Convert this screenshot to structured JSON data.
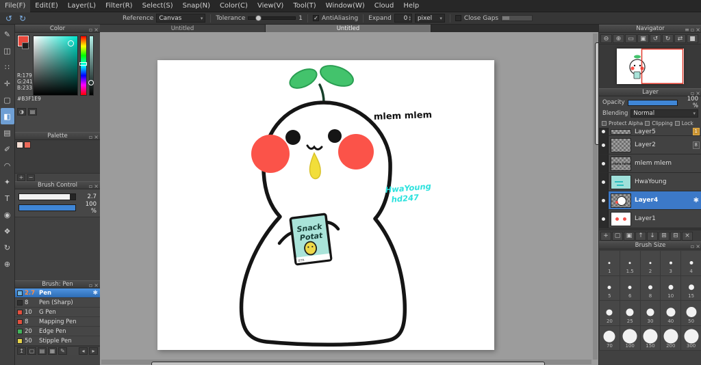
{
  "icons": {
    "float": "▫",
    "close": "×",
    "caret": "▾",
    "check": "✓",
    "undo": "↺",
    "redo": "↻",
    "spin_up": "▴",
    "spin_down": "▾",
    "gear": "✱",
    "menu": "≡"
  },
  "menu": {
    "items": [
      "File(F)",
      "Edit(E)",
      "Layer(L)",
      "Filter(R)",
      "Select(S)",
      "Snap(N)",
      "Color(C)",
      "View(V)",
      "Tool(T)",
      "Window(W)",
      "Cloud",
      "Help"
    ]
  },
  "options_toolbar": {
    "reference_label": "Reference",
    "reference_value": "Canvas",
    "tolerance_label": "Tolerance",
    "tolerance_value": "1",
    "antialiasing_label": "AntiAliasing",
    "expand_label": "Expand",
    "expand_value": "0",
    "unit_value": "pixel",
    "close_gaps_label": "Close Gaps"
  },
  "tabs": [
    {
      "label": "Untitled"
    },
    {
      "label": "Untitled"
    }
  ],
  "tools": [
    {
      "name": "brush-tool",
      "glyph": "✎"
    },
    {
      "name": "eraser-tool",
      "glyph": "◫"
    },
    {
      "name": "dot-tool",
      "glyph": "∷"
    },
    {
      "name": "move-tool",
      "glyph": "✛"
    },
    {
      "name": "select-tool",
      "glyph": "▢"
    },
    {
      "name": "fill-tool",
      "glyph": "◧"
    },
    {
      "name": "gradient-tool",
      "glyph": "▤"
    },
    {
      "name": "select-pen-tool",
      "glyph": "✐"
    },
    {
      "name": "lasso-tool",
      "glyph": "◠"
    },
    {
      "name": "magic-wand-tool",
      "glyph": "✦"
    },
    {
      "name": "text-tool",
      "glyph": "T"
    },
    {
      "name": "eyedropper-tool",
      "glyph": "◉"
    },
    {
      "name": "hand-tool",
      "glyph": "❖"
    },
    {
      "name": "rotate-tool",
      "glyph": "↻"
    },
    {
      "name": "zoom-tool",
      "glyph": "⊕"
    }
  ],
  "color_panel": {
    "title": "Color",
    "r_label": "R:179",
    "g_label": "G:241",
    "b_label": "B:233",
    "hex": "#B3F1E9",
    "foreground": "#e8483c",
    "background": "#1e1e1e",
    "buttons": [
      {
        "name": "color-wheel-toggle",
        "glyph": "◑"
      },
      {
        "name": "slider-mode-toggle",
        "glyph": "▤"
      }
    ]
  },
  "palette_panel": {
    "title": "Palette",
    "swatches": [
      "#f5ded4",
      "#ec6a5a"
    ],
    "footer_icons": [
      {
        "name": "add-color-button",
        "glyph": "+"
      },
      {
        "name": "delete-color-button",
        "glyph": "−"
      }
    ]
  },
  "brush_control": {
    "title": "Brush Control",
    "size_value": "2.7",
    "opacity_value": "100 %"
  },
  "brush_panel": {
    "title": "Brush: Pen",
    "brushes": [
      {
        "size": "2.7",
        "name": "Pen",
        "chip": "#6ab2e4",
        "selected": true
      },
      {
        "size": "8",
        "name": "Pen (Sharp)",
        "chip": "#303030"
      },
      {
        "size": "10",
        "name": "G Pen",
        "chip": "#e2503f"
      },
      {
        "size": "8",
        "name": "Mapping Pen",
        "chip": "#e2503f"
      },
      {
        "size": "20",
        "name": "Edge Pen",
        "chip": "#43b45c"
      },
      {
        "size": "50",
        "name": "Stipple Pen",
        "chip": "#e7d44a"
      }
    ],
    "footer_icons": [
      {
        "name": "add-brush-button",
        "glyph": "↥"
      },
      {
        "name": "new-brush-button",
        "glyph": "▢"
      },
      {
        "name": "brush-folder-button",
        "glyph": "▤"
      },
      {
        "name": "save-brush-button",
        "glyph": "▦"
      },
      {
        "name": "edit-brush-button",
        "glyph": "✎"
      },
      {
        "name": "prev-brush-button",
        "glyph": "◂"
      },
      {
        "name": "next-brush-button",
        "glyph": "▸"
      }
    ]
  },
  "canvas": {
    "texts": {
      "mlem": "mlem mlem",
      "sig1": "HwaYoung",
      "sig2": "hd247",
      "packet1": "Snack",
      "packet2": "Potat",
      "packet_small": "BTR"
    }
  },
  "navigator": {
    "title": "Navigator",
    "buttons": [
      {
        "name": "zoom-out-button",
        "glyph": "⊖"
      },
      {
        "name": "zoom-in-button",
        "glyph": "⊕"
      },
      {
        "name": "fit-window-button",
        "glyph": "▭"
      },
      {
        "name": "actual-size-button",
        "glyph": "▣"
      },
      {
        "name": "rotate-ccw-button",
        "glyph": "↺"
      },
      {
        "name": "rotate-cw-button",
        "glyph": "↻"
      },
      {
        "name": "flip-button",
        "glyph": "⇄"
      },
      {
        "name": "reset-view-button",
        "glyph": "■"
      }
    ]
  },
  "layer_panel": {
    "title": "Layer",
    "opacity_label": "Opacity",
    "opacity_value": "100 %",
    "blending_label": "Blending",
    "blending_value": "Normal",
    "protect_alpha_label": "Protect Alpha",
    "clipping_label": "Clipping",
    "lock_label": "Lock",
    "layers": [
      {
        "name": "Layer5",
        "badge": "1"
      },
      {
        "name": "Layer2",
        "badge": "8"
      },
      {
        "name": "mlem mlem"
      },
      {
        "name": "HwaYoung"
      },
      {
        "name": "Layer4",
        "selected": true
      },
      {
        "name": "Layer1"
      }
    ],
    "toolbar": [
      {
        "name": "add-layer-button",
        "glyph": "+"
      },
      {
        "name": "duplicate-layer-button",
        "glyph": "▢"
      },
      {
        "name": "merge-layer-button",
        "glyph": "▣"
      },
      {
        "name": "move-layer-up-button",
        "glyph": "↑"
      },
      {
        "name": "move-layer-down-button",
        "glyph": "↓"
      },
      {
        "name": "add-folder-button",
        "glyph": "⊞"
      },
      {
        "name": "clear-layer-button",
        "glyph": "⊟"
      },
      {
        "name": "delete-layer-button",
        "glyph": "×"
      }
    ]
  },
  "brush_size_panel": {
    "title": "Brush Size",
    "sizes": [
      "1",
      "1.5",
      "2",
      "3",
      "4",
      "5",
      "6",
      "8",
      "10",
      "15",
      "20",
      "25",
      "30",
      "40",
      "50",
      "70",
      "100",
      "150",
      "200",
      "300"
    ]
  }
}
